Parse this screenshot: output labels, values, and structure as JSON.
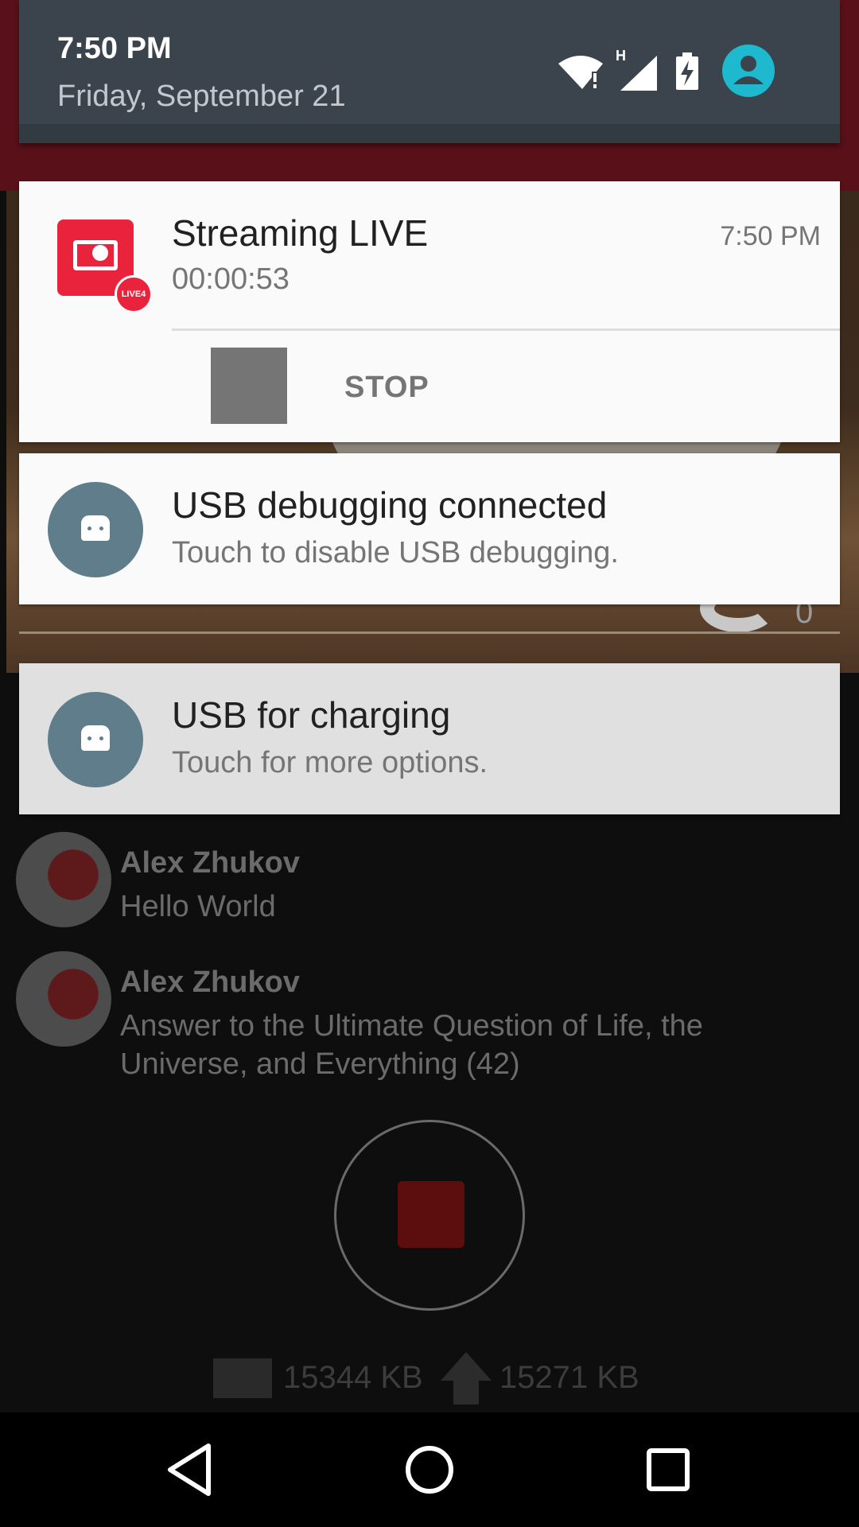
{
  "status": {
    "time": "7:50 PM",
    "date": "Friday, September 21",
    "icons": [
      "wifi-alert-icon",
      "signal-h-icon",
      "battery-charging-icon",
      "user-avatar-icon"
    ],
    "signal_type": "H",
    "accent_color": "#1eb8cf"
  },
  "notifications": [
    {
      "title": "Streaming LIVE",
      "subtitle": "00:00:53",
      "time": "7:50 PM",
      "action_label": "STOP",
      "icon": "live-streaming-app-icon",
      "badge": "LIVE4",
      "brand_color": "#e8233b"
    },
    {
      "title": "USB debugging connected",
      "subtitle": "Touch to disable USB debugging.",
      "icon": "android-icon"
    },
    {
      "title": "USB for charging",
      "subtitle": "Touch for more options.",
      "icon": "android-icon"
    }
  ],
  "background_app": {
    "hero_count": "0",
    "messages": [
      {
        "author": "Alex Zhukov",
        "text": "Hello World"
      },
      {
        "author": "Alex Zhukov",
        "text": "Answer to the Ultimate Question of Life, the Universe, and Everything (42)"
      }
    ],
    "stats": {
      "received": "15344 KB",
      "sent": "15271 KB"
    },
    "record_color": "#5c0d0d"
  },
  "navbar": {
    "buttons": [
      "back-icon",
      "home-icon",
      "recents-icon"
    ]
  }
}
